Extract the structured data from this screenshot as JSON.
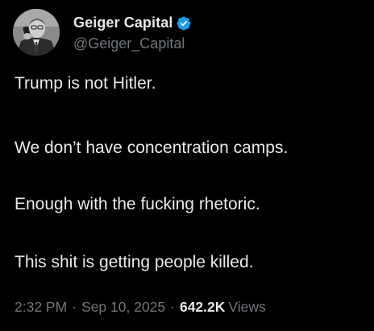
{
  "author": {
    "display_name": "Geiger Capital",
    "handle": "@Geiger_Capital",
    "verified": true,
    "verified_color": "#1d9bf0",
    "avatar": "grayscale-portrait-man-on-phone"
  },
  "post": {
    "lines": [
      "Trump is not Hitler.",
      "We don’t have concentration camps.",
      "Enough with the fucking rhetoric.",
      "This shit is getting people killed."
    ]
  },
  "meta": {
    "time": "2:32 PM",
    "separator": "·",
    "date": "Sep 10, 2025",
    "views_count": "642.2K",
    "views_label": "Views"
  },
  "colors": {
    "background": "#000000",
    "primary_text": "#e7e9ea",
    "secondary_text": "#71767b"
  }
}
